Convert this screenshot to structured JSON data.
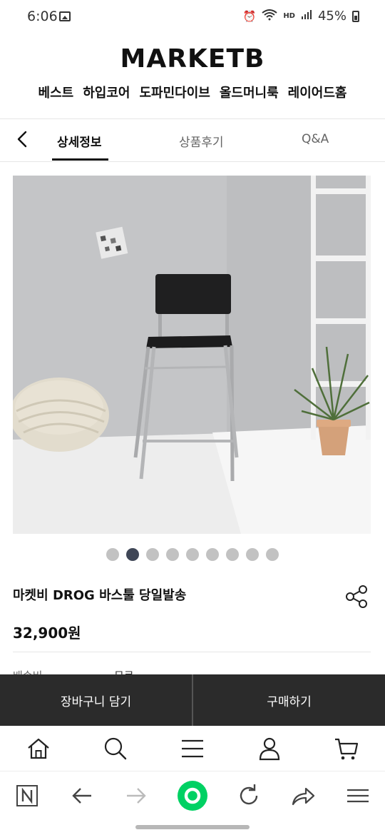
{
  "status": {
    "time": "6:06",
    "network": "HD",
    "battery": "45%"
  },
  "header": {
    "logo": "MARKETB",
    "categories": [
      "베스트",
      "하입코어",
      "도파민다이브",
      "올드머니룩",
      "레이어드홈"
    ]
  },
  "tabs": [
    {
      "label": "상세정보",
      "active": true
    },
    {
      "label": "상품후기",
      "active": false
    },
    {
      "label": "Q&A",
      "active": false
    }
  ],
  "gallery": {
    "dots": 9,
    "active_index": 2
  },
  "product": {
    "title": "마켓비 DROG 바스툴 당일발송",
    "price": "32,900원",
    "shipping_label": "배송비",
    "shipping_value": "무료"
  },
  "actions": {
    "cart": "장바구니 담기",
    "buy": "구매하기"
  },
  "colors": {
    "dark_bar": "#2b2b2b",
    "active_dot": "#3f4656",
    "browser_accent": "#00d163"
  }
}
